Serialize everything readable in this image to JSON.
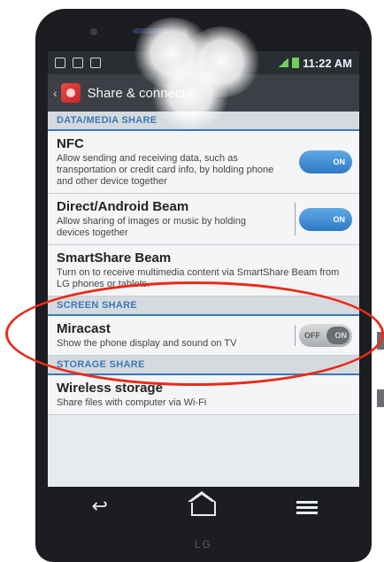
{
  "status_bar": {
    "time": "11:22 AM"
  },
  "action_bar": {
    "title": "Share & connect"
  },
  "sections": [
    {
      "header": "DATA/MEDIA SHARE"
    },
    {
      "header": "SCREEN SHARE"
    },
    {
      "header": "STORAGE SHARE"
    }
  ],
  "items": {
    "nfc": {
      "label": "NFC",
      "desc": "Allow sending and receiving data, such as transportation or credit card info, by holding phone and other device together",
      "toggle": "ON"
    },
    "beam": {
      "label": "Direct/Android Beam",
      "desc": "Allow sharing of images or music by holding devices together",
      "toggle": "ON"
    },
    "smartshare": {
      "label": "SmartShare Beam",
      "desc": "Turn on to receive multimedia content via SmartShare Beam from LG phones or tablets."
    },
    "miracast": {
      "label": "Miracast",
      "desc": "Show the phone display and sound on TV",
      "toggle_off": "OFF",
      "toggle_on": "ON"
    },
    "wireless": {
      "label": "Wireless storage",
      "desc": "Share files with computer via Wi-Fi"
    }
  },
  "brand": "LG",
  "colors": {
    "accent": "#3a78b8",
    "annotation": "#ea2a18",
    "toggle_on": "#2d79c4"
  }
}
